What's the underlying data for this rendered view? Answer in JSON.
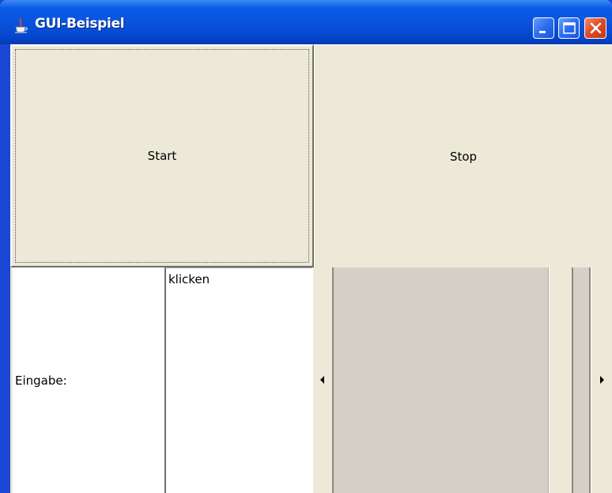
{
  "window": {
    "title": "GUI-Beispiel",
    "icon": "java-cup-icon",
    "controls": [
      "minimize-icon",
      "maximize-icon",
      "close-icon"
    ]
  },
  "buttons": {
    "start_label": "Start",
    "stop_label": "Stop"
  },
  "input_row": {
    "label": "Eingabe:",
    "textfield_value": "klicken"
  },
  "colors": {
    "titlebar": "#0a54de",
    "client_bg": "#ece9d8",
    "close_button": "#dc4a23"
  }
}
